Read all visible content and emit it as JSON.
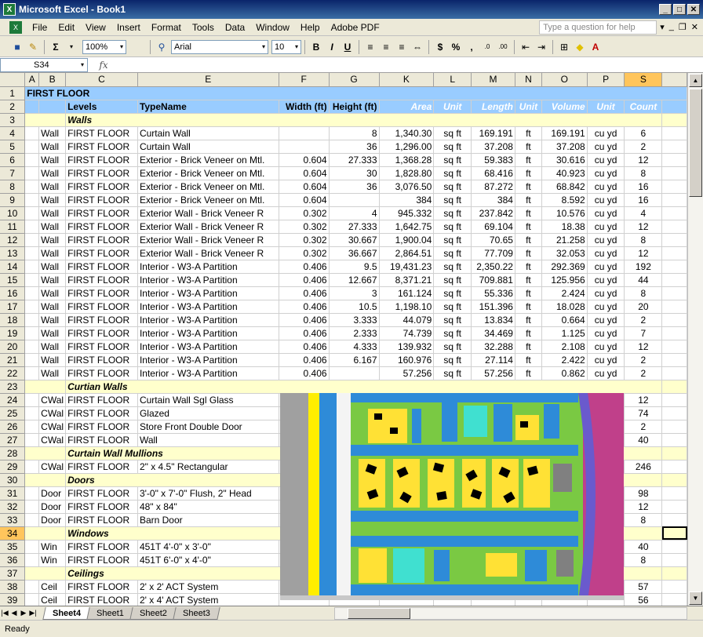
{
  "window": {
    "title": "Microsoft Excel - Book1"
  },
  "menu": {
    "items": [
      "File",
      "Edit",
      "View",
      "Insert",
      "Format",
      "Tools",
      "Data",
      "Window",
      "Help",
      "Adobe PDF"
    ],
    "help_placeholder": "Type a question for help"
  },
  "toolbar": {
    "zoom": "100%",
    "font": "Arial",
    "size": "10",
    "icons": [
      "save-icon",
      "format-painter-icon",
      "autosum-icon",
      "find-icon",
      "bold-icon",
      "italic-icon",
      "underline-icon",
      "align-left-icon",
      "align-center-icon",
      "align-right-icon",
      "merge-center-icon",
      "currency-icon",
      "percent-icon",
      "comma-icon",
      "increase-decimal-icon",
      "decrease-decimal-icon",
      "decrease-indent-icon",
      "increase-indent-icon",
      "borders-icon",
      "fill-color-icon",
      "font-color-icon"
    ]
  },
  "formula": {
    "namebox": "S34",
    "fx": "fx",
    "value": ""
  },
  "columns": [
    "A",
    "B",
    "C",
    "E",
    "F",
    "G",
    "K",
    "L",
    "M",
    "N",
    "O",
    "P",
    "S"
  ],
  "rows": [
    {
      "n": "1",
      "type": "title",
      "cells": [
        "FIRST FLOOR"
      ]
    },
    {
      "n": "2",
      "type": "hdr",
      "cells": [
        "",
        "",
        "Levels",
        "TypeName",
        "Width (ft)",
        "Height (ft)",
        "Area",
        "Unit",
        "Length",
        "Unit",
        "Volume",
        "Unit",
        "Count"
      ]
    },
    {
      "n": "3",
      "type": "sec",
      "cells": [
        "Walls"
      ]
    },
    {
      "n": "4",
      "type": "data",
      "cells": [
        "",
        "Wall",
        "FIRST FLOOR",
        "Curtain Wall",
        "",
        "8",
        "1,340.30",
        "sq ft",
        "169.191",
        "ft",
        "169.191",
        "cu yd",
        "6"
      ]
    },
    {
      "n": "5",
      "type": "data",
      "cells": [
        "",
        "Wall",
        "FIRST FLOOR",
        "Curtain Wall",
        "",
        "36",
        "1,296.00",
        "sq ft",
        "37.208",
        "ft",
        "37.208",
        "cu yd",
        "2"
      ]
    },
    {
      "n": "6",
      "type": "data",
      "cells": [
        "",
        "Wall",
        "FIRST FLOOR",
        "Exterior - Brick Veneer on Mtl.",
        "0.604",
        "27.333",
        "1,368.28",
        "sq ft",
        "59.383",
        "ft",
        "30.616",
        "cu yd",
        "12"
      ]
    },
    {
      "n": "7",
      "type": "data",
      "cells": [
        "",
        "Wall",
        "FIRST FLOOR",
        "Exterior - Brick Veneer on Mtl.",
        "0.604",
        "30",
        "1,828.80",
        "sq ft",
        "68.416",
        "ft",
        "40.923",
        "cu yd",
        "8"
      ]
    },
    {
      "n": "8",
      "type": "data",
      "cells": [
        "",
        "Wall",
        "FIRST FLOOR",
        "Exterior - Brick Veneer on Mtl.",
        "0.604",
        "36",
        "3,076.50",
        "sq ft",
        "87.272",
        "ft",
        "68.842",
        "cu yd",
        "16"
      ]
    },
    {
      "n": "9",
      "type": "data",
      "cells": [
        "",
        "Wall",
        "FIRST FLOOR",
        "Exterior - Brick Veneer on Mtl.",
        "0.604",
        "",
        "384",
        "sq ft",
        "384",
        "ft",
        "8.592",
        "cu yd",
        "16"
      ]
    },
    {
      "n": "10",
      "type": "data",
      "cells": [
        "",
        "Wall",
        "FIRST FLOOR",
        "Exterior Wall - Brick Veneer R",
        "0.302",
        "4",
        "945.332",
        "sq ft",
        "237.842",
        "ft",
        "10.576",
        "cu yd",
        "4"
      ]
    },
    {
      "n": "11",
      "type": "data",
      "cells": [
        "",
        "Wall",
        "FIRST FLOOR",
        "Exterior Wall - Brick Veneer R",
        "0.302",
        "27.333",
        "1,642.75",
        "sq ft",
        "69.104",
        "ft",
        "18.38",
        "cu yd",
        "12"
      ]
    },
    {
      "n": "12",
      "type": "data",
      "cells": [
        "",
        "Wall",
        "FIRST FLOOR",
        "Exterior Wall - Brick Veneer R",
        "0.302",
        "30.667",
        "1,900.04",
        "sq ft",
        "70.65",
        "ft",
        "21.258",
        "cu yd",
        "8"
      ]
    },
    {
      "n": "13",
      "type": "data",
      "cells": [
        "",
        "Wall",
        "FIRST FLOOR",
        "Exterior Wall - Brick Veneer R",
        "0.302",
        "36.667",
        "2,864.51",
        "sq ft",
        "77.709",
        "ft",
        "32.053",
        "cu yd",
        "12"
      ]
    },
    {
      "n": "14",
      "type": "data",
      "cells": [
        "",
        "Wall",
        "FIRST FLOOR",
        "Interior - W3-A Partition",
        "0.406",
        "9.5",
        "19,431.23",
        "sq ft",
        "2,350.22",
        "ft",
        "292.369",
        "cu yd",
        "192"
      ]
    },
    {
      "n": "15",
      "type": "data",
      "cells": [
        "",
        "Wall",
        "FIRST FLOOR",
        "Interior - W3-A Partition",
        "0.406",
        "12.667",
        "8,371.21",
        "sq ft",
        "709.881",
        "ft",
        "125.956",
        "cu yd",
        "44"
      ]
    },
    {
      "n": "16",
      "type": "data",
      "cells": [
        "",
        "Wall",
        "FIRST FLOOR",
        "Interior - W3-A Partition",
        "0.406",
        "3",
        "161.124",
        "sq ft",
        "55.336",
        "ft",
        "2.424",
        "cu yd",
        "8"
      ]
    },
    {
      "n": "17",
      "type": "data",
      "cells": [
        "",
        "Wall",
        "FIRST FLOOR",
        "Interior - W3-A Partition",
        "0.406",
        "10.5",
        "1,198.10",
        "sq ft",
        "151.396",
        "ft",
        "18.028",
        "cu yd",
        "20"
      ]
    },
    {
      "n": "18",
      "type": "data",
      "cells": [
        "",
        "Wall",
        "FIRST FLOOR",
        "Interior - W3-A Partition",
        "0.406",
        "3.333",
        "44.079",
        "sq ft",
        "13.834",
        "ft",
        "0.664",
        "cu yd",
        "2"
      ]
    },
    {
      "n": "19",
      "type": "data",
      "cells": [
        "",
        "Wall",
        "FIRST FLOOR",
        "Interior - W3-A Partition",
        "0.406",
        "2.333",
        "74.739",
        "sq ft",
        "34.469",
        "ft",
        "1.125",
        "cu yd",
        "7"
      ]
    },
    {
      "n": "20",
      "type": "data",
      "cells": [
        "",
        "Wall",
        "FIRST FLOOR",
        "Interior - W3-A Partition",
        "0.406",
        "4.333",
        "139.932",
        "sq ft",
        "32.288",
        "ft",
        "2.108",
        "cu yd",
        "12"
      ]
    },
    {
      "n": "21",
      "type": "data",
      "cells": [
        "",
        "Wall",
        "FIRST FLOOR",
        "Interior - W3-A Partition",
        "0.406",
        "6.167",
        "160.976",
        "sq ft",
        "27.114",
        "ft",
        "2.422",
        "cu yd",
        "2"
      ]
    },
    {
      "n": "22",
      "type": "data",
      "cells": [
        "",
        "Wall",
        "FIRST FLOOR",
        "Interior - W3-A Partition",
        "0.406",
        "",
        "57.256",
        "sq ft",
        "57.256",
        "ft",
        "0.862",
        "cu yd",
        "2"
      ]
    },
    {
      "n": "23",
      "type": "sec",
      "cells": [
        "Curtian Walls"
      ]
    },
    {
      "n": "24",
      "type": "data",
      "cells": [
        "",
        "CWal",
        "FIRST FLOOR",
        "Curtain Wall Sgl Glass",
        "",
        "",
        "",
        "",
        "",
        "",
        "",
        "",
        "12"
      ]
    },
    {
      "n": "25",
      "type": "data",
      "cells": [
        "",
        "CWal",
        "FIRST FLOOR",
        "Glazed",
        "",
        "",
        "",
        "",
        "",
        "",
        "",
        "",
        "74"
      ]
    },
    {
      "n": "26",
      "type": "data",
      "cells": [
        "",
        "CWal",
        "FIRST FLOOR",
        "Store Front Double Door",
        "",
        "",
        "",
        "",
        "",
        "",
        "",
        "",
        "2"
      ]
    },
    {
      "n": "27",
      "type": "data",
      "cells": [
        "",
        "CWal",
        "FIRST FLOOR",
        "Wall",
        "",
        "",
        "",
        "",
        "",
        "",
        "",
        "",
        "40"
      ]
    },
    {
      "n": "28",
      "type": "sec",
      "cells": [
        "Curtain Wall Mullions"
      ]
    },
    {
      "n": "29",
      "type": "data",
      "cells": [
        "",
        "CWal",
        "FIRST FLOOR",
        "2\" x 4.5\" Rectangular",
        "",
        "",
        "",
        "",
        "",
        "",
        "",
        "",
        "246"
      ]
    },
    {
      "n": "30",
      "type": "sec",
      "cells": [
        "Doors"
      ]
    },
    {
      "n": "31",
      "type": "data",
      "cells": [
        "",
        "Door",
        "FIRST FLOOR",
        "3'-0\" x 7'-0\" Flush, 2\" Head",
        "",
        "",
        "",
        "",
        "",
        "",
        "",
        "",
        "98"
      ]
    },
    {
      "n": "32",
      "type": "data",
      "cells": [
        "",
        "Door",
        "FIRST FLOOR",
        "48\" x 84\"",
        "",
        "",
        "",
        "",
        "",
        "",
        "",
        "",
        "12"
      ]
    },
    {
      "n": "33",
      "type": "data",
      "cells": [
        "",
        "Door",
        "FIRST FLOOR",
        "Barn Door",
        "",
        "",
        "",
        "",
        "",
        "",
        "",
        "",
        "8"
      ]
    },
    {
      "n": "34",
      "type": "sec",
      "cells": [
        "Windows"
      ]
    },
    {
      "n": "35",
      "type": "data",
      "cells": [
        "",
        "Win",
        "FIRST FLOOR",
        "451T 4'-0\" x 3'-0\"",
        "",
        "",
        "",
        "",
        "",
        "",
        "",
        "",
        "40"
      ]
    },
    {
      "n": "36",
      "type": "data",
      "cells": [
        "",
        "Win",
        "FIRST FLOOR",
        "451T 6'-0\" x 4'-0\"",
        "",
        "",
        "",
        "",
        "",
        "",
        "",
        "",
        "8"
      ]
    },
    {
      "n": "37",
      "type": "sec",
      "cells": [
        "Ceilings"
      ]
    },
    {
      "n": "38",
      "type": "data",
      "cells": [
        "",
        "Ceil",
        "FIRST FLOOR",
        "2' x 2' ACT System",
        "",
        "",
        "",
        "",
        "",
        "",
        "",
        "",
        "57"
      ]
    },
    {
      "n": "39",
      "type": "data",
      "cells": [
        "",
        "Ceil",
        "FIRST FLOOR",
        "2' x 4' ACT System",
        "",
        "",
        "",
        "",
        "",
        "",
        "",
        "",
        "56"
      ]
    }
  ],
  "sheets": [
    "Sheet4",
    "Sheet1",
    "Sheet2",
    "Sheet3"
  ],
  "status": "Ready"
}
